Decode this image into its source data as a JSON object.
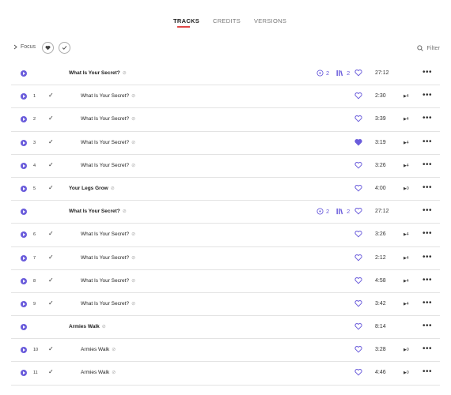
{
  "tabs": [
    {
      "label": "TRACKS",
      "active": true
    },
    {
      "label": "CREDITS",
      "active": false
    },
    {
      "label": "VERSIONS",
      "active": false
    }
  ],
  "controls": {
    "focus_label": "Focus",
    "filter_label": "Filter"
  },
  "colors": {
    "accent": "#6a5cdb",
    "tab_underline": "#e04848"
  },
  "rows": [
    {
      "type": "group",
      "title": "What Is Your Secret?",
      "versions": "2",
      "discs": "2",
      "heart_filled": false,
      "duration": "27:12"
    },
    {
      "type": "track",
      "num": "1",
      "title": "What Is Your Secret?",
      "heart_filled": false,
      "duration": "2:30",
      "plays": "4"
    },
    {
      "type": "track",
      "num": "2",
      "title": "What Is Your Secret?",
      "heart_filled": false,
      "duration": "3:39",
      "plays": "4"
    },
    {
      "type": "track",
      "num": "3",
      "title": "What Is Your Secret?",
      "heart_filled": true,
      "duration": "3:19",
      "plays": "4"
    },
    {
      "type": "track",
      "num": "4",
      "title": "What Is Your Secret?",
      "heart_filled": false,
      "duration": "3:26",
      "plays": "4"
    },
    {
      "type": "single",
      "num": "5",
      "title": "Your Legs Grow",
      "heart_filled": false,
      "duration": "4:00",
      "plays": "0"
    },
    {
      "type": "group",
      "title": "What Is Your Secret?",
      "versions": "2",
      "discs": "2",
      "heart_filled": false,
      "duration": "27:12"
    },
    {
      "type": "track",
      "num": "6",
      "title": "What Is Your Secret?",
      "heart_filled": false,
      "duration": "3:26",
      "plays": "4"
    },
    {
      "type": "track",
      "num": "7",
      "title": "What Is Your Secret?",
      "heart_filled": false,
      "duration": "2:12",
      "plays": "4"
    },
    {
      "type": "track",
      "num": "8",
      "title": "What Is Your Secret?",
      "heart_filled": false,
      "duration": "4:58",
      "plays": "4"
    },
    {
      "type": "track",
      "num": "9",
      "title": "What Is Your Secret?",
      "heart_filled": false,
      "duration": "3:42",
      "plays": "4"
    },
    {
      "type": "group",
      "title": "Armies Walk",
      "heart_filled": false,
      "duration": "8:14"
    },
    {
      "type": "track",
      "num": "10",
      "title": "Armies Walk",
      "heart_filled": false,
      "duration": "3:28",
      "plays": "0"
    },
    {
      "type": "track",
      "num": "11",
      "title": "Armies Walk",
      "heart_filled": false,
      "duration": "4:46",
      "plays": "0"
    }
  ]
}
